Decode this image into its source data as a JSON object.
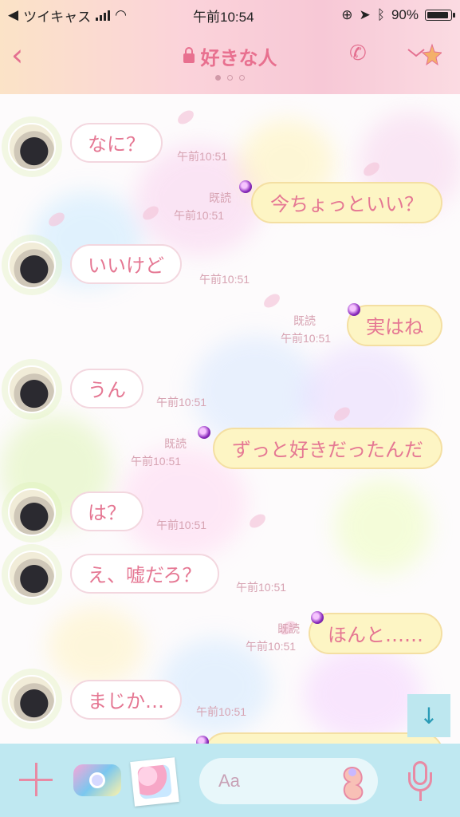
{
  "status_bar": {
    "carrier_back": "ツイキャス",
    "time": "午前10:54",
    "battery": "90%"
  },
  "header": {
    "back_icon": "chevron-left-icon",
    "title": "好きな人",
    "lock_icon": "lock-icon",
    "call_icon": "phone-icon",
    "menu_icon": "chevron-down-icon"
  },
  "pager": {
    "total": 3,
    "active": 0
  },
  "messages": [
    {
      "side": "in",
      "text": "なに？",
      "time": "午前10:51"
    },
    {
      "side": "out",
      "text": "今ちょっといい？",
      "time": "午前10:51",
      "read": "既読"
    },
    {
      "side": "in",
      "text": "いいけど",
      "time": "午前10:51"
    },
    {
      "side": "out",
      "text": "実はね",
      "time": "午前10:51",
      "read": "既読"
    },
    {
      "side": "in",
      "text": "うん",
      "time": "午前10:51"
    },
    {
      "side": "out",
      "text": "ずっと好きだったんだ",
      "time": "午前10:51",
      "read": "既読"
    },
    {
      "side": "in",
      "text": "は？",
      "time": "午前10:51"
    },
    {
      "side": "in",
      "text": "え、嘘だろ？",
      "time": "午前10:51"
    },
    {
      "side": "out",
      "text": "ほんと……",
      "time": "午前10:51",
      "read": "既読"
    },
    {
      "side": "in",
      "text": "まじか…",
      "time": "午前10:51"
    }
  ],
  "composer": {
    "placeholder": "Aa",
    "plus_icon": "plus-icon",
    "camera_icon": "camera-icon",
    "sticker_icon": "sticker-icon",
    "mic_icon": "microphone-icon"
  },
  "scroll_down_icon": "arrow-down-icon",
  "colors": {
    "accent_pink": "#e8708f",
    "bubble_out": "#fdf5c4",
    "composer_bg": "#bfe8f1"
  }
}
